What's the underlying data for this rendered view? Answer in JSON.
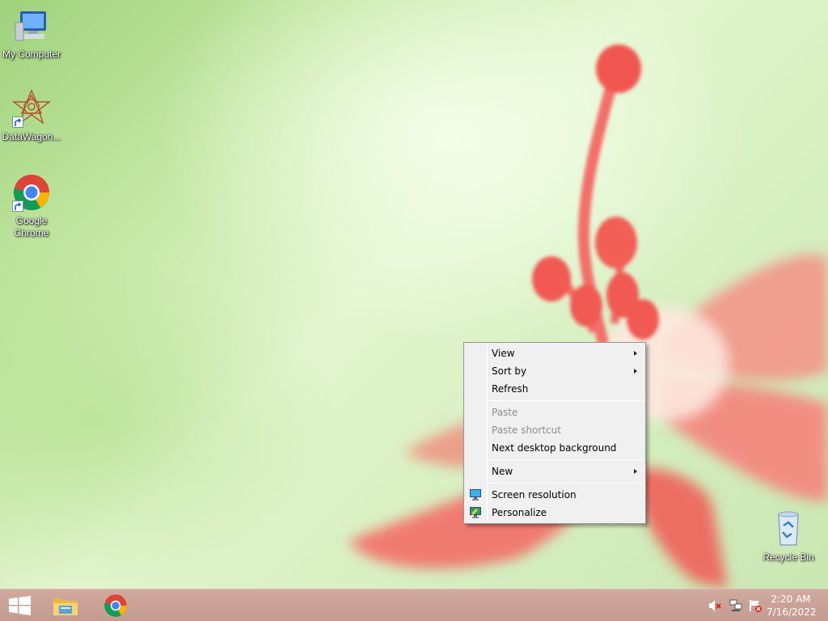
{
  "desktop": {
    "icons": [
      {
        "label": "My Computer",
        "icon": "computer-icon"
      },
      {
        "label": "DataWagon...",
        "icon": "datawagon-icon"
      },
      {
        "label": "Google Chrome",
        "icon": "chrome-icon"
      },
      {
        "label": "Recycle Bin",
        "icon": "recycle-bin-icon"
      }
    ]
  },
  "context_menu": {
    "items": [
      {
        "label": "View",
        "submenu": true,
        "enabled": true
      },
      {
        "label": "Sort by",
        "submenu": true,
        "enabled": true
      },
      {
        "label": "Refresh",
        "submenu": false,
        "enabled": true
      },
      {
        "label": "Paste",
        "submenu": false,
        "enabled": false
      },
      {
        "label": "Paste shortcut",
        "submenu": false,
        "enabled": false
      },
      {
        "label": "Next desktop background",
        "submenu": false,
        "enabled": true
      },
      {
        "label": "New",
        "submenu": true,
        "enabled": true
      },
      {
        "label": "Screen resolution",
        "submenu": false,
        "enabled": true,
        "icon": "display-icon"
      },
      {
        "label": "Personalize",
        "submenu": false,
        "enabled": true,
        "icon": "personalize-icon"
      }
    ]
  },
  "taskbar": {
    "pinned": [
      {
        "name": "Start",
        "icon": "windows-logo-icon"
      },
      {
        "name": "File Explorer",
        "icon": "folder-icon"
      },
      {
        "name": "Google Chrome",
        "icon": "chrome-icon"
      }
    ],
    "tray": {
      "icons": [
        "volume-muted-icon",
        "network-icon",
        "action-center-flag-icon"
      ],
      "time": "2:20 AM",
      "date": "7/16/2022"
    }
  },
  "colors": {
    "taskbar": "#c9a196",
    "menu_bg": "#f0f0f0",
    "flower": "#f0706a"
  }
}
